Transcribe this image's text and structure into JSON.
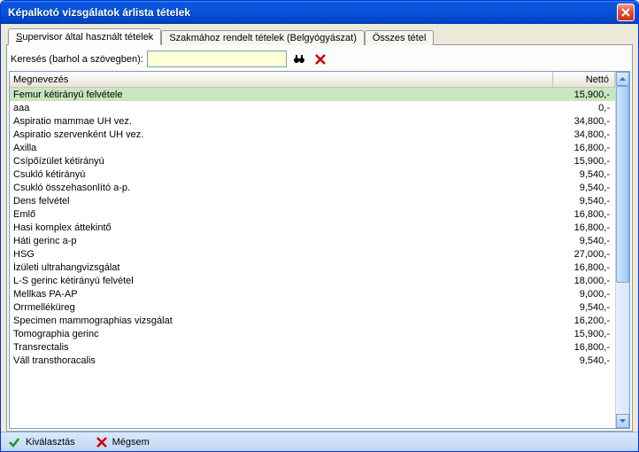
{
  "window": {
    "title": "Képalkotó vizsgálatok árlista tételek"
  },
  "tabs": [
    {
      "label": "Supervisor által használt tételek",
      "active": true,
      "underline": "S"
    },
    {
      "label": "Szakmához rendelt tételek (Belgyógyászat)",
      "active": false
    },
    {
      "label": "Összes tétel",
      "active": false
    }
  ],
  "search": {
    "label": "Keresés (barhol a szövegben):",
    "value": ""
  },
  "columns": {
    "name": "Megnevezés",
    "price": "Nettó"
  },
  "rows": [
    {
      "name": "Femur kétirányú felvétele",
      "price": "15,900,-",
      "selected": true
    },
    {
      "name": "aaa",
      "price": "0,-"
    },
    {
      "name": "Aspiratio mammae UH vez.",
      "price": "34,800,-"
    },
    {
      "name": "Aspiratio szervenként UH vez.",
      "price": "34,800,-"
    },
    {
      "name": "Axilla",
      "price": "16,800,-"
    },
    {
      "name": "Csípőízület kétirányú",
      "price": "15,900,-"
    },
    {
      "name": "Csukló kétirányú",
      "price": "9,540,-"
    },
    {
      "name": "Csukló összehasonlító a-p.",
      "price": "9,540,-"
    },
    {
      "name": "Dens felvétel",
      "price": "9,540,-"
    },
    {
      "name": "Emlő",
      "price": "16,800,-"
    },
    {
      "name": "Hasi komplex áttekintő",
      "price": "16,800,-"
    },
    {
      "name": "Háti gerinc a-p",
      "price": "9,540,-"
    },
    {
      "name": "HSG",
      "price": "27,000,-"
    },
    {
      "name": "Ízületi ultrahangvizsgálat",
      "price": "16,800,-"
    },
    {
      "name": "L-S gerinc kétirányú felvétel",
      "price": "18,000,-"
    },
    {
      "name": "Mellkas PA-AP",
      "price": "9,000,-"
    },
    {
      "name": "Orrmelléküreg",
      "price": "9,540,-"
    },
    {
      "name": "Specimen mammographias vizsgálat",
      "price": "16,200,-"
    },
    {
      "name": "Tomographia gerinc",
      "price": "15,900,-"
    },
    {
      "name": "Transrectalis",
      "price": "16,800,-"
    },
    {
      "name": "Váll transthoracalis",
      "price": "9,540,-"
    }
  ],
  "footer": {
    "select": "Kiválasztás",
    "cancel": "Mégsem"
  }
}
